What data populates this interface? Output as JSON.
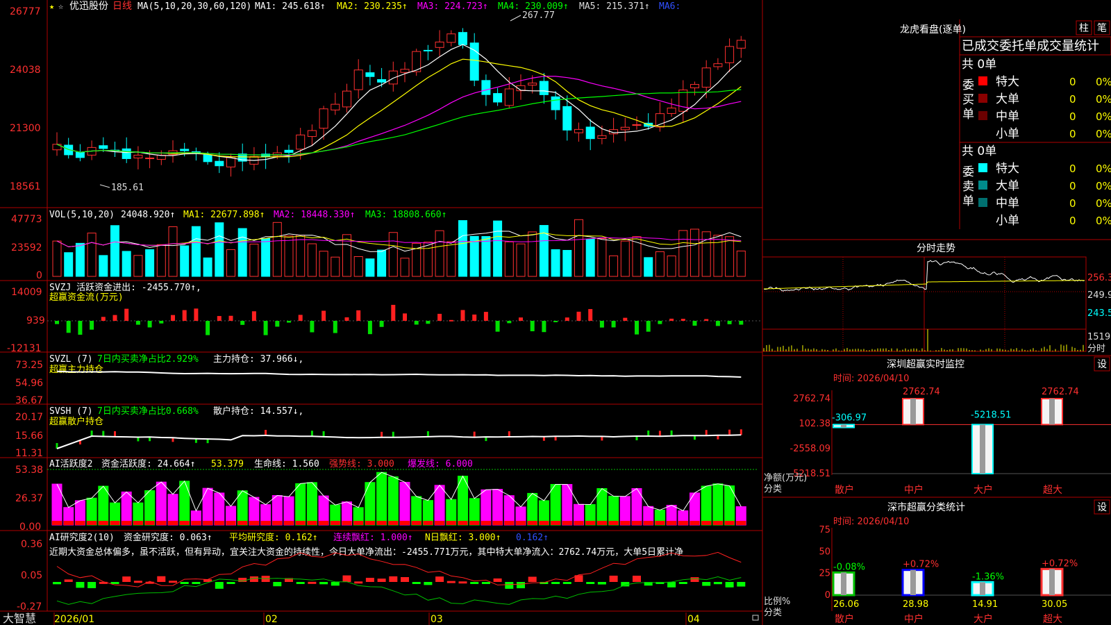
{
  "stock": {
    "name": "优迅股份",
    "period": "日线"
  },
  "footer_brand": "大智慧",
  "dates": [
    "2026/01",
    "02",
    "03",
    "04"
  ],
  "kline": {
    "header": {
      "ma_set": "MA(5,10,20,30,60,120)",
      "ma1": "MA1: 245.618↑",
      "ma2": "MA2: 230.235↑",
      "ma3": "MA3: 224.723↑",
      "ma4": "MA4: 230.009↑",
      "ma5": "MA5: 215.371↑",
      "ma6": "MA6:"
    },
    "yticks": [
      "26777",
      "24038",
      "21300",
      "18561"
    ],
    "high_label": "267.77",
    "low_label": "185.61"
  },
  "vol": {
    "header": {
      "name": "VOL(5,10,20)",
      "value": "24048.920↑",
      "ma1": "MA1: 22677.898↑",
      "ma2": "MA2: 18448.330↑",
      "ma3": "MA3: 18808.660↑"
    },
    "yticks": [
      "47773",
      "23592",
      "0"
    ]
  },
  "svzj": {
    "line1": "SVZJ  活跃资金进出: -2455.770↑,",
    "line2": "超赢资金流(万元)",
    "yticks": [
      "14009",
      "939",
      "-12131"
    ]
  },
  "svzl": {
    "line1a": "SVZL (7)",
    "line1b": "7日内买卖净占比2.929%",
    "line1c": "主力持仓: 37.966↓,",
    "line2": "超赢主力持仓",
    "yticks": [
      "73.25",
      "54.96",
      "36.67"
    ]
  },
  "svsh": {
    "line1a": "SVSH (7)",
    "line1b": "7日内买卖净占比0.668%",
    "line1c": "散户持仓: 14.557↓,",
    "line2": "超赢散户持仓",
    "yticks": [
      "20.17",
      "15.66",
      "11.31"
    ]
  },
  "ai1": {
    "name": "AI活跃度2",
    "v1": "资金活跃度: 24.664↑",
    "v2": "53.379",
    "v3": "生命线: 1.560",
    "v4": "强势线: 3.000",
    "v5": "爆发线: 6.000",
    "yticks": [
      "53.38",
      "26.37",
      "0.00"
    ]
  },
  "ai2": {
    "name": "AI研究度2(10)",
    "v1": "资金研究度: 0.063↑",
    "v2": "平均研究度: 0.162↑",
    "v3": "连续飘红: 1.000↑",
    "v4": "N日飘红: 3.000↑",
    "v5": "0.162↑",
    "comment": "近期大资金总体偏多，虽不活跃，但有异动，宜关注大资金的持续性，今日大单净流出：-2455.771万元，其中特大单净流入：2762.74万元，大单5日累计净",
    "yticks": [
      "0.36",
      "0.05",
      "-0.27"
    ]
  },
  "longhu": {
    "title": "龙虎看盘(逐单)",
    "btn1": "柱",
    "btn2": "笔",
    "tabs": [
      "已成交",
      "委托单",
      "成交量统计"
    ],
    "buy": {
      "side": "委买单",
      "total": "共 0单",
      "rows": [
        {
          "label": "特大",
          "count": "0",
          "pct": "0%",
          "color": "#ff0000"
        },
        {
          "label": "大单",
          "count": "0",
          "pct": "0%",
          "color": "#8b0000"
        },
        {
          "label": "中单",
          "count": "0",
          "pct": "0%",
          "color": "#6a0000"
        },
        {
          "label": "小单",
          "count": "0",
          "pct": "0%",
          "color": ""
        }
      ]
    },
    "sell": {
      "side": "委卖单",
      "total": "共 0单",
      "rows": [
        {
          "label": "特大",
          "count": "0",
          "pct": "0%",
          "color": "#00ffff"
        },
        {
          "label": "大单",
          "count": "0",
          "pct": "0%",
          "color": "#008b8b"
        },
        {
          "label": "中单",
          "count": "0",
          "pct": "0%",
          "color": "#007070"
        },
        {
          "label": "小单",
          "count": "0",
          "pct": "0%",
          "color": ""
        }
      ]
    }
  },
  "intraday": {
    "title": "分时走势",
    "yticks": [
      "256.3",
      "249.9",
      "243.5"
    ],
    "vol_tick": "1519",
    "vol_unit": "分时"
  },
  "monitor": {
    "title": "深圳超赢实时监控",
    "btn": "设",
    "time_label": "时间: 2026/04/10",
    "yticks": [
      "2762.74",
      "102.38",
      "-2558.09",
      "-5218.51"
    ],
    "ylabel": "净额(万元)",
    "xlabel": "分类",
    "categories": [
      "散户",
      "中户",
      "大户",
      "超大"
    ],
    "values": [
      -306.97,
      2762.74,
      -5218.51,
      2762.74
    ],
    "value_labels": [
      "-306.97",
      "2762.74",
      "-5218.51",
      "2762.74"
    ]
  },
  "classify": {
    "title": "深市超赢分类统计",
    "btn": "设",
    "time_label": "时间: 2026/04/10",
    "yticks": [
      "75",
      "50",
      "25",
      "0"
    ],
    "ylabel": "比例%",
    "xlabel": "分类",
    "categories": [
      "散户",
      "中户",
      "大户",
      "超大"
    ],
    "values": [
      26.06,
      28.98,
      14.91,
      30.05
    ],
    "changes": [
      "-0.08%",
      "+0.72%",
      "-1.36%",
      "+0.72%"
    ]
  },
  "chart_data": [
    {
      "type": "candlestick",
      "title": "优迅股份 日线",
      "x": [
        "2026/01",
        "02",
        "03",
        "04"
      ],
      "ylim": [
        185.61,
        267.77
      ],
      "values": {
        "MA1": 245.618,
        "MA2": 230.235,
        "MA3": 224.723,
        "MA4": 230.009,
        "MA5": 215.371
      },
      "annotations": [
        {
          "label": "267.77",
          "type": "high"
        },
        {
          "label": "185.61",
          "type": "low"
        }
      ]
    },
    {
      "type": "bar",
      "title": "深圳超赢实时监控",
      "categories": [
        "散户",
        "中户",
        "大户",
        "超大"
      ],
      "values": [
        -306.97,
        2762.74,
        -5218.51,
        2762.74
      ],
      "ylabel": "净额(万元)",
      "xlabel": "分类",
      "ylim": [
        -5218.51,
        2762.74
      ]
    },
    {
      "type": "bar",
      "title": "深市超赢分类统计",
      "categories": [
        "散户",
        "中户",
        "大户",
        "超大"
      ],
      "values": [
        26.06,
        28.98,
        14.91,
        30.05
      ],
      "ylabel": "比例%",
      "xlabel": "分类",
      "ylim": [
        0,
        75
      ]
    }
  ]
}
